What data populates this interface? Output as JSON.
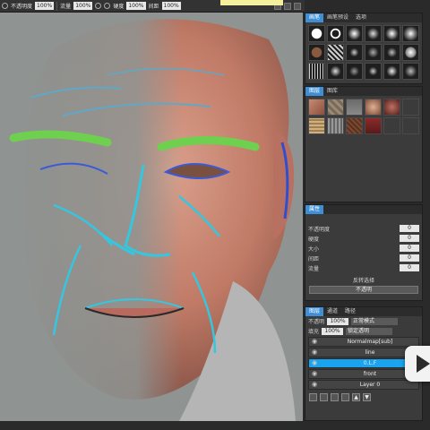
{
  "toolbar": {
    "items": [
      {
        "label": "不透明度",
        "value": "100%"
      },
      {
        "label": "流量",
        "value": "100%"
      },
      {
        "label": "硬度",
        "value": "100%"
      },
      {
        "label": "间距",
        "value": "100%"
      }
    ]
  },
  "brushes": {
    "tabs": [
      "画笔",
      "画笔预设",
      "选项"
    ],
    "count": 18
  },
  "textures": {
    "tabs": [
      "图层",
      "图库"
    ],
    "count": 12
  },
  "properties": {
    "tab": "属性",
    "rows": [
      {
        "label": "不透明度",
        "value": "0"
      },
      {
        "label": "硬度",
        "value": "0"
      },
      {
        "label": "大小",
        "value": "0"
      },
      {
        "label": "间距",
        "value": "0"
      },
      {
        "label": "流量",
        "value": "0"
      }
    ],
    "center_label": "反转选择",
    "dropdown": "不透明"
  },
  "layers": {
    "tabs": [
      "图层",
      "通道",
      "路径"
    ],
    "opacity_label": "不透明",
    "opacity": "100%",
    "blend": "正常模式",
    "fill_label": "填充",
    "fill": "100%",
    "lock": "锁定透明",
    "items": [
      {
        "name": "Normalmap[sub]",
        "selected": false
      },
      {
        "name": "line",
        "selected": false
      },
      {
        "name": "0.L.F",
        "selected": true
      },
      {
        "name": "front",
        "selected": false
      },
      {
        "name": "Layer 0",
        "selected": false
      }
    ]
  }
}
